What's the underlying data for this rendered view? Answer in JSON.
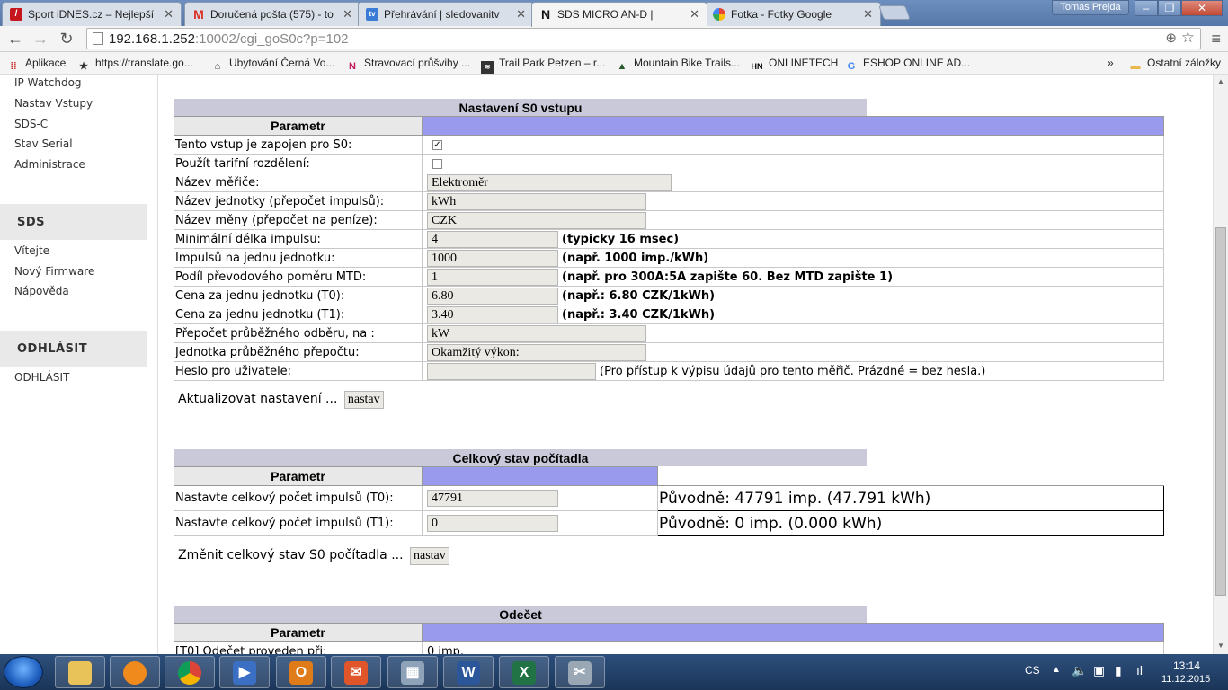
{
  "browser": {
    "tabs": [
      {
        "title": "Sport iDNES.cz – Nejlepší",
        "icon": "idnes-icon",
        "color": "#c4161c"
      },
      {
        "title": "Doručená pošta (575) - to",
        "icon": "gmail-icon",
        "color": "#d93025"
      },
      {
        "title": "Přehrávání | sledovanitv",
        "icon": "tv-icon",
        "color": "#3a7bd5"
      },
      {
        "title": "SDS MICRO AN-D |",
        "icon": "sds-icon",
        "color": "#111111"
      },
      {
        "title": "Fotka - Fotky Google",
        "icon": "photos-icon",
        "color": "#f4b400"
      }
    ],
    "user_name": "Tomas Prejda",
    "url_host": "192.168.1.252",
    "url_rest": ":10002/cgi_goS0c?p=102",
    "bookmarks": [
      {
        "label": "Aplikace",
        "icon": "apps-icon"
      },
      {
        "label": "https://translate.go...",
        "icon": "star-icon"
      },
      {
        "label": "Ubytování Černá Vo...",
        "icon": "house-icon"
      },
      {
        "label": "Stravovací průšvihy ...",
        "icon": "n-icon"
      },
      {
        "label": "Trail Park Petzen – r...",
        "icon": "trail-icon"
      },
      {
        "label": "Mountain Bike Trails...",
        "icon": "mountain-icon"
      },
      {
        "label": "ONLINETECH",
        "icon": "hn-icon"
      },
      {
        "label": "ESHOP ONLINE AD...",
        "icon": "google-icon"
      }
    ],
    "bookmarks_more": "»",
    "other_bookmarks": "Ostatní záložky"
  },
  "sidebar": {
    "links_top": [
      "IP Watchdog",
      "Nastav Vstupy",
      "SDS-C",
      "Stav Serial",
      "Administrace"
    ],
    "sds_heading": "SDS",
    "sds_links": [
      "Vítejte",
      "Nový Firmware",
      "Nápověda"
    ],
    "logout_heading": "ODHLÁSIT",
    "logout_link": "ODHLÁSIT"
  },
  "s0_settings": {
    "title": "Nastavení S0 vstupu",
    "param_header": "Parametr",
    "rows": {
      "connected_label": "Tento vstup je zapojen pro S0:",
      "connected_checked": true,
      "tariff_label": "Použít tarifní rozdělení:",
      "tariff_checked": false,
      "meter_name_label": "Název měřiče:",
      "meter_name_value": "Elektroměr",
      "unit_name_label": "Název jednotky (přepočet impulsů):",
      "unit_name_value": "kWh",
      "currency_label": "Název měny (přepočet na peníze):",
      "currency_value": "CZK",
      "min_pulse_label": "Minimální délka impulsu:",
      "min_pulse_value": "4",
      "min_pulse_note": "(typicky 16 msec)",
      "pulses_label": "Impulsů na jednu jednotku:",
      "pulses_value": "1000",
      "pulses_note": "(např. 1000 imp./kWh)",
      "mtd_label": "Podíl převodového poměru MTD:",
      "mtd_value": "1",
      "mtd_note": "(např. pro 300A:5A zapište 60. Bez MTD zapište 1)",
      "price_t0_label": "Cena za jednu jednotku (T0):",
      "price_t0_value": "6.80",
      "price_t0_note": "(např.: 6.80 CZK/1kWh)",
      "price_t1_label": "Cena za jednu jednotku (T1):",
      "price_t1_value": "3.40",
      "price_t1_note": "(např.: 3.40 CZK/1kWh)",
      "conv_label": "Přepočet průběžného odběru, na :",
      "conv_value": "kW",
      "conv_unit_label": "Jednotka průběžného přepočtu:",
      "conv_unit_value": "Okamžitý výkon:",
      "password_label": "Heslo pro uživatele:",
      "password_value": "",
      "password_note": "(Pro přístup k výpisu údajů pro tento měřič. Prázdné = bez hesla.)"
    },
    "update_label": "Aktualizovat nastavení ...",
    "update_button": "nastav"
  },
  "counter": {
    "title": "Celkový stav počítadla",
    "param_header": "Parametr",
    "t0_label": "Nastavte celkový počet impulsů (T0):",
    "t0_value": "47791",
    "t0_orig": "Původně: 47791 imp. (47.791 kWh)",
    "t1_label": "Nastavte celkový počet impulsů (T1):",
    "t1_value": "0",
    "t1_orig": "Původně: 0 imp. (0.000 kWh)",
    "change_label": "Změnit celkový stav S0 počítadla ...",
    "change_button": "nastav"
  },
  "reading": {
    "title": "Odečet",
    "param_header": "Parametr",
    "t0_label": "[T0] Odečet proveden při:",
    "t0_value": "0 imp."
  },
  "taskbar": {
    "lang": "CS",
    "time": "13:14",
    "date": "11.12.2015"
  }
}
